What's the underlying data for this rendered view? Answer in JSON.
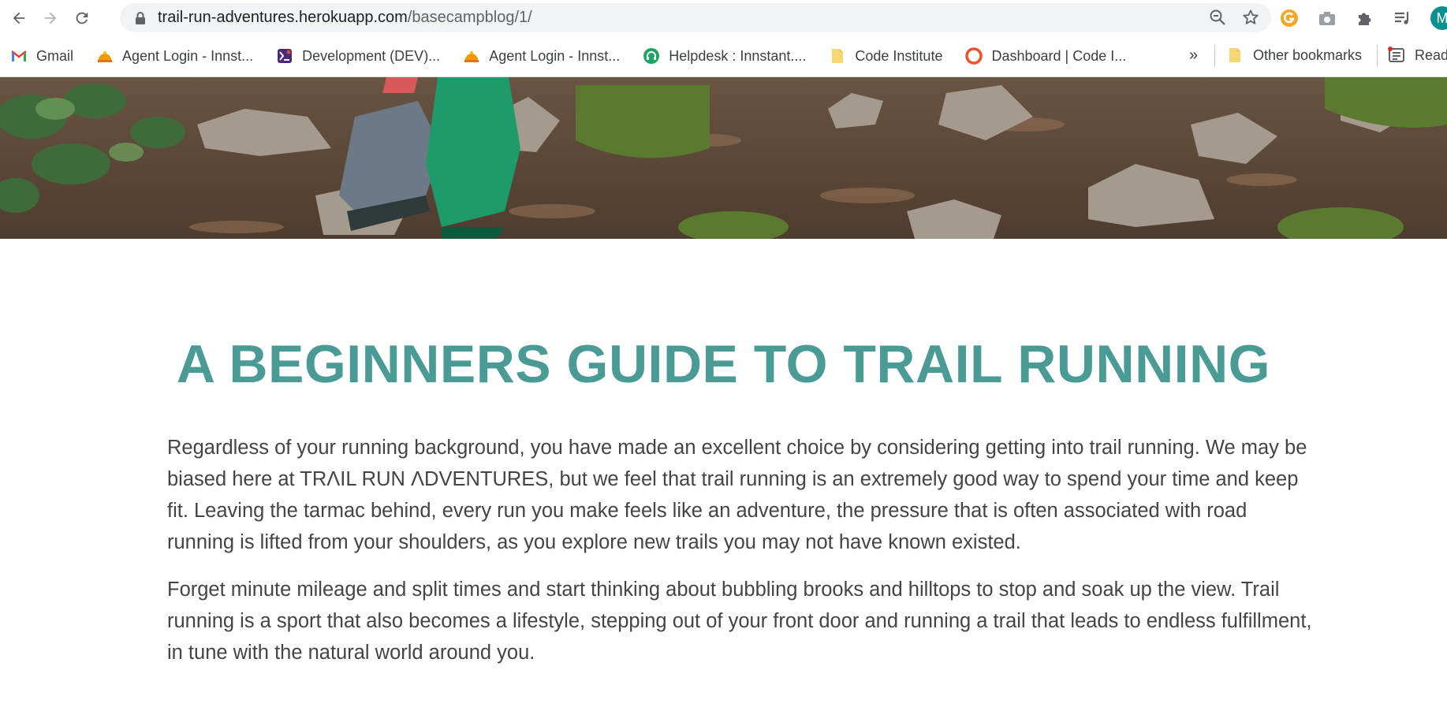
{
  "browser": {
    "url_host": "trail-run-adventures.herokuapp.com",
    "url_path": "/basecampblog/1/",
    "profile_initial": "M",
    "bookmarks": [
      {
        "label": "Gmail",
        "icon": "gmail-icon"
      },
      {
        "label": "Agent Login - Innst...",
        "icon": "agent-icon"
      },
      {
        "label": "Development (DEV)...",
        "icon": "dev-icon"
      },
      {
        "label": "Agent Login - Innst...",
        "icon": "agent-icon"
      },
      {
        "label": "Helpdesk : Innstant....",
        "icon": "helpdesk-icon"
      },
      {
        "label": "Code Institute",
        "icon": "folder-icon"
      },
      {
        "label": "Dashboard | Code I...",
        "icon": "dashboard-icon"
      }
    ],
    "bookmarks_overflow": "»",
    "other_bookmarks": "Other bookmarks",
    "reading_list": "Read"
  },
  "article": {
    "title": "A BEGINNERS GUIDE TO TRAIL RUNNING",
    "paragraphs": [
      "Regardless of your running background, you have made an excellent choice by considering getting into trail running. We may be biased here at TRΛIL RUN ΛDVENTURES, but we feel that trail running is an extremely good way to spend your time and keep fit. Leaving the tarmac behind, every run you make feels like an adventure, the pressure that is often associated with road running is lifted from your shoulders, as you explore new trails you may not have known existed.",
      "Forget minute mileage and split times and start thinking about bubbling brooks and hilltops to stop and soak up the view. Trail running is a sport that also becomes a lifestyle, stepping out of your front door and running a trail that leads to endless fulfillment, in tune with the natural world around you."
    ]
  },
  "colors": {
    "title": "#4a9a96",
    "body_text": "#444444",
    "omnibox_bg": "#f1f3f4"
  }
}
